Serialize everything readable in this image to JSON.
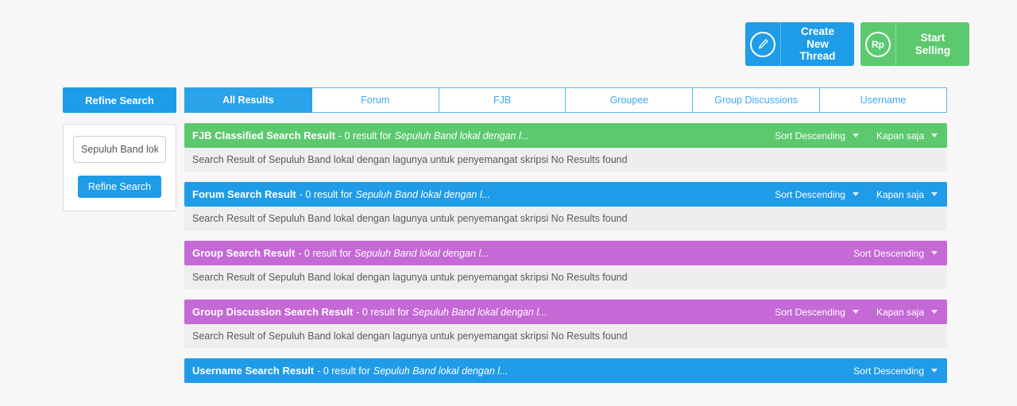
{
  "topbar": {
    "buttons": [
      {
        "label": "Create New Thread",
        "icon": "pencil-icon",
        "icon_glyph": "✎",
        "color": "#1e9ce8",
        "name": "create-new-thread-button"
      },
      {
        "label": "Start Selling",
        "icon": "rupiah-icon",
        "icon_glyph": "Rp",
        "color": "#5cc96f",
        "name": "start-selling-button"
      }
    ]
  },
  "sidebar": {
    "header": "Refine Search",
    "input_value": "Sepuluh Band lokal",
    "input_placeholder": "Sepuluh Band lokal",
    "button_label": "Refine Search"
  },
  "tabs": [
    {
      "label": "All Results",
      "active": true
    },
    {
      "label": "Forum",
      "active": false
    },
    {
      "label": "FJB",
      "active": false
    },
    {
      "label": "Groupee",
      "active": false
    },
    {
      "label": "Group Discussions",
      "active": false
    },
    {
      "label": "Username",
      "active": false
    }
  ],
  "results": [
    {
      "title": "FJB Classified Search Result",
      "separator": "- 0 result for",
      "query": "Sepuluh Band lokal dengan l...",
      "color": "#5cc96f",
      "sort_label": "Sort Descending",
      "time_label": "Kapan saja",
      "has_time_filter": true,
      "body": "Search Result of Sepuluh Band lokal dengan lagunya untuk penyemangat skripsi No Results found",
      "has_body": true
    },
    {
      "title": "Forum Search Result",
      "separator": "- 0 result for",
      "query": "Sepuluh Band lokal dengan l...",
      "color": "#1e9ce8",
      "sort_label": "Sort Descending",
      "time_label": "Kapan saja",
      "has_time_filter": true,
      "body": "Search Result of Sepuluh Band lokal dengan lagunya untuk penyemangat skripsi No Results found",
      "has_body": true
    },
    {
      "title": "Group Search Result",
      "separator": "- 0 result for",
      "query": "Sepuluh Band lokal dengan l...",
      "color": "#c569d6",
      "sort_label": "Sort Descending",
      "time_label": "",
      "has_time_filter": false,
      "body": "Search Result of Sepuluh Band lokal dengan lagunya untuk penyemangat skripsi No Results found",
      "has_body": true
    },
    {
      "title": "Group Discussion Search Result",
      "separator": "- 0 result for",
      "query": "Sepuluh Band lokal dengan l...",
      "color": "#c569d6",
      "sort_label": "Sort Descending",
      "time_label": "Kapan saja",
      "has_time_filter": true,
      "body": "Search Result of Sepuluh Band lokal dengan lagunya untuk penyemangat skripsi No Results found",
      "has_body": true
    },
    {
      "title": "Username Search Result",
      "separator": "- 0 result for",
      "query": "Sepuluh Band lokal dengan l...",
      "color": "#1e9ce8",
      "sort_label": "Sort Descending",
      "time_label": "",
      "has_time_filter": false,
      "body": "",
      "has_body": false
    }
  ],
  "colors": {
    "page_bg": "#f7f7f7",
    "blue": "#1e9ce8",
    "green": "#5cc96f",
    "purple": "#c569d6",
    "body_bg": "#eeeeee"
  }
}
